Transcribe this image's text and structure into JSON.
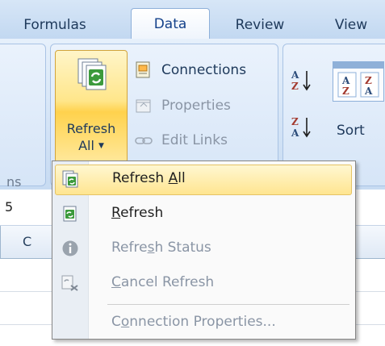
{
  "tabs": [
    {
      "label": "Formulas"
    },
    {
      "label": "Data"
    },
    {
      "label": "Review"
    },
    {
      "label": "View"
    }
  ],
  "ribbon": {
    "left_group_fragment": "ns",
    "refresh_all": {
      "line1": "Refresh",
      "line2": "All",
      "caret": "▼"
    },
    "connections": {
      "label": "Connections"
    },
    "properties": {
      "label": "Properties"
    },
    "edit_links": {
      "label": "Edit Links"
    },
    "sort": {
      "label": "Sort"
    }
  },
  "sheet": {
    "name_box_fragment": "5",
    "column_label": "C"
  },
  "menu": {
    "items": [
      {
        "pre": "Refresh ",
        "accel": "A",
        "post": "ll",
        "enabled": true,
        "highlighted": true
      },
      {
        "pre": "",
        "accel": "R",
        "post": "efresh",
        "enabled": true
      },
      {
        "pre": "Refre",
        "accel": "s",
        "post": "h Status",
        "enabled": false
      },
      {
        "pre": "",
        "accel": "C",
        "post": "ancel Refresh",
        "enabled": false
      },
      {
        "pre": "C",
        "accel": "o",
        "post": "nnection Properties...",
        "enabled": false
      }
    ]
  },
  "colors": {
    "ribbon_blue": "#c2d8f1",
    "hover_gold": "#ffe590",
    "disabled_text": "#8a95a5",
    "tab_text": "#1e395b"
  }
}
